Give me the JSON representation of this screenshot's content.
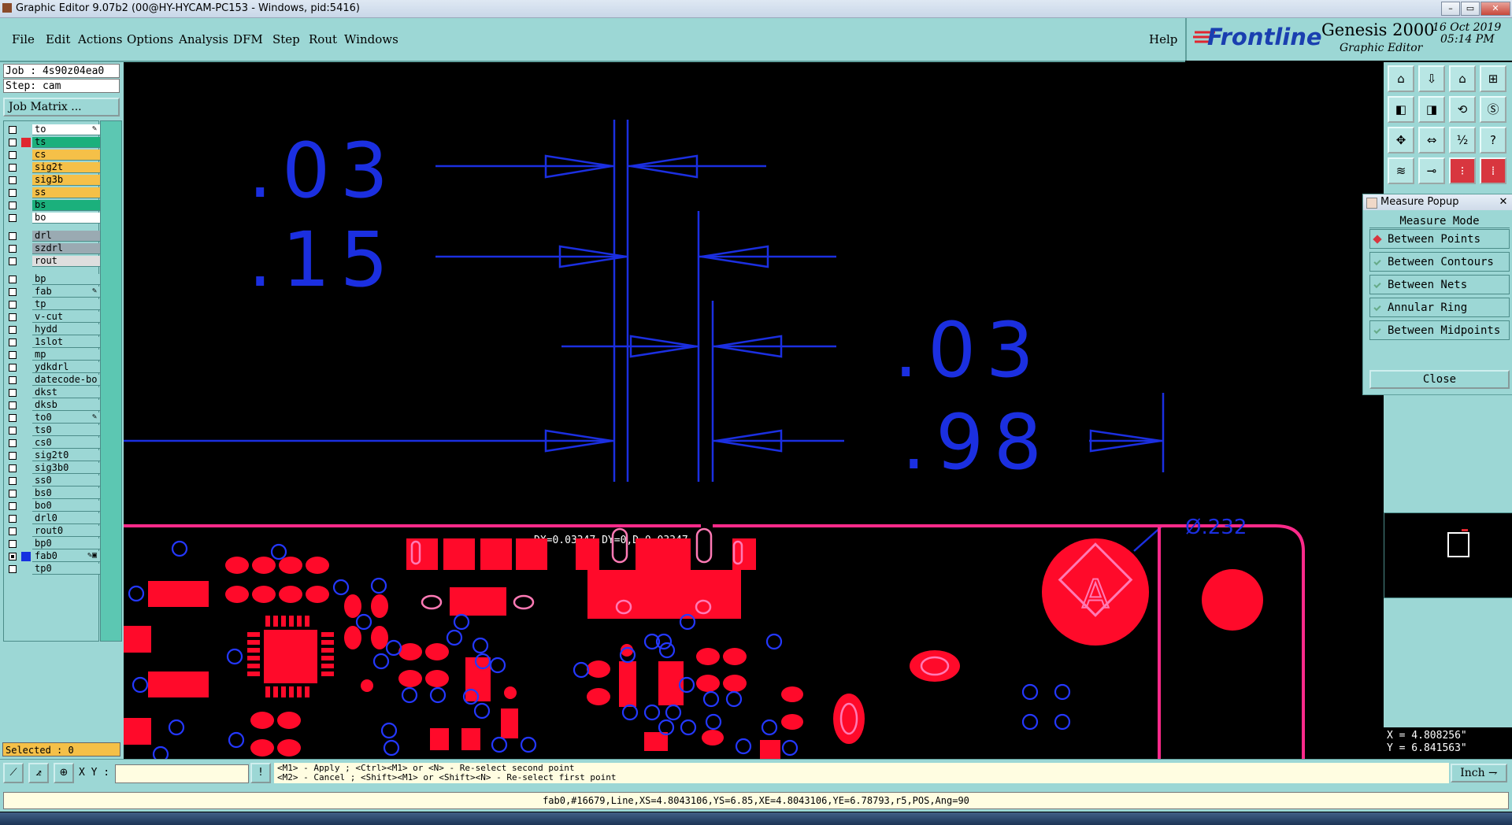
{
  "window": {
    "title": "Graphic Editor 9.07b2 (00@HY-HYCAM-PC153 - Windows, pid:5416)"
  },
  "menu": [
    "File",
    "Edit",
    "Actions",
    "Options",
    "Analysis",
    "DFM",
    "Step",
    "Rout",
    "Windows"
  ],
  "help_label": "Help",
  "brand": {
    "logo": "Frontline",
    "product": "Genesis 2000",
    "subtitle": "Graphic Editor",
    "date": "16 Oct 2019",
    "time": "05:14 PM"
  },
  "job": {
    "job_line": "Job : 4s90z04ea0",
    "step_line": "Step: cam",
    "matrix_button": "Job Matrix ..."
  },
  "layers": [
    {
      "name": "to",
      "bg": "#ffffff",
      "mark": "✎"
    },
    {
      "name": "ts",
      "bg": "#1bb07c",
      "swatch": "#e0262f"
    },
    {
      "name": "cs",
      "bg": "#f5c048"
    },
    {
      "name": "sig2t",
      "bg": "#f5c048"
    },
    {
      "name": "sig3b",
      "bg": "#f5c048"
    },
    {
      "name": "ss",
      "bg": "#f5c048"
    },
    {
      "name": "bs",
      "bg": "#1bb07c"
    },
    {
      "name": "bo",
      "bg": "#ffffff"
    },
    {
      "name": "drl",
      "bg": "#9aaab2",
      "gap": true
    },
    {
      "name": "szdrl",
      "bg": "#9aaab2"
    },
    {
      "name": "rout",
      "bg": "#dedede"
    },
    {
      "name": "bp",
      "bg": "#9cd7d5",
      "gap": true
    },
    {
      "name": "fab",
      "bg": "#9cd7d5",
      "mark": "✎"
    },
    {
      "name": "tp",
      "bg": "#9cd7d5"
    },
    {
      "name": "v-cut",
      "bg": "#9cd7d5"
    },
    {
      "name": "hydd",
      "bg": "#9cd7d5"
    },
    {
      "name": "1slot",
      "bg": "#9cd7d5"
    },
    {
      "name": "mp",
      "bg": "#9cd7d5"
    },
    {
      "name": "ydkdrl",
      "bg": "#9cd7d5"
    },
    {
      "name": "datecode-bo",
      "bg": "#9cd7d5"
    },
    {
      "name": "dkst",
      "bg": "#9cd7d5"
    },
    {
      "name": "dksb",
      "bg": "#9cd7d5"
    },
    {
      "name": "to0",
      "bg": "#9cd7d5",
      "mark": "✎"
    },
    {
      "name": "ts0",
      "bg": "#9cd7d5"
    },
    {
      "name": "cs0",
      "bg": "#9cd7d5"
    },
    {
      "name": "sig2t0",
      "bg": "#9cd7d5"
    },
    {
      "name": "sig3b0",
      "bg": "#9cd7d5"
    },
    {
      "name": "ss0",
      "bg": "#9cd7d5"
    },
    {
      "name": "bs0",
      "bg": "#9cd7d5"
    },
    {
      "name": "bo0",
      "bg": "#9cd7d5"
    },
    {
      "name": "drl0",
      "bg": "#9cd7d5"
    },
    {
      "name": "rout0",
      "bg": "#9cd7d5"
    },
    {
      "name": "bp0",
      "bg": "#9cd7d5"
    },
    {
      "name": "fab0",
      "bg": "#9cd7d5",
      "swatch": "#1530e0",
      "checked": true,
      "mark": "✎▣"
    },
    {
      "name": "tp0",
      "bg": "#9cd7d5"
    }
  ],
  "selected": "Selected : 0",
  "canvas": {
    "dims": [
      ".03",
      ".15",
      ".03",
      ".98"
    ],
    "measure_readout": "DX=0.03347,DY=0,D=0.03347",
    "diameter_label": "Ø.232",
    "fiducial_letter": "A",
    "colors": {
      "measure": "#1b2fe0",
      "copper": "#ff0a2a",
      "outline": "#ff2a8a",
      "holes": "#2438ff"
    }
  },
  "measure_popup": {
    "title": "Measure Popup",
    "header": "Measure Mode",
    "options": [
      "Between Points",
      "Between Contours",
      "Between Nets",
      "Annular Ring",
      "Between Midpoints"
    ],
    "selected_option": "Between Points",
    "close": "Close"
  },
  "coords": {
    "x": "X = 4.808256\"",
    "y": "Y = 6.841563\""
  },
  "bottom": {
    "xy_label": "X Y :",
    "help_line1": "<M1> - Apply  ; <Ctrl><M1> or <N> - Re-select second point",
    "help_line2": "<M2> - Cancel ; <Shift><M1> or <Shift><N> - Re-select first point",
    "unit": "Inch"
  },
  "status": "fab0,#16679,Line,XS=4.8043106,YS=6.85,XE=4.8043106,YE=6.78793,r5,POS,Ang=90"
}
